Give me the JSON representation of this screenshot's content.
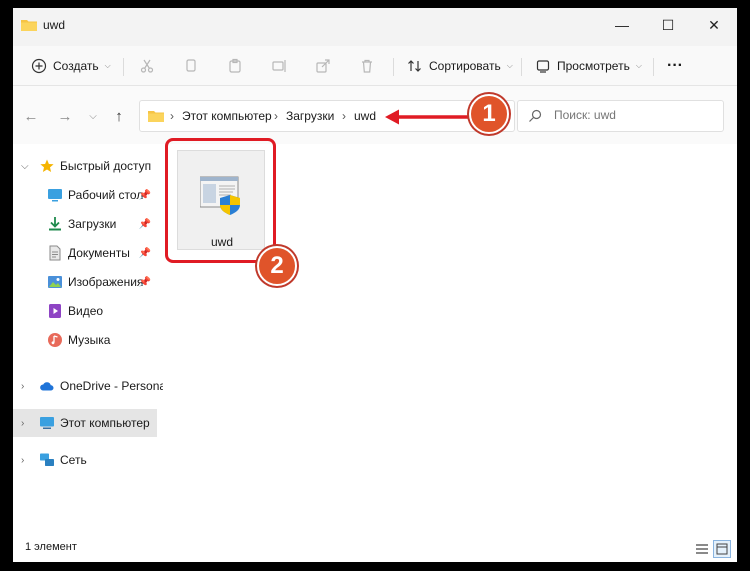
{
  "window": {
    "title": "uwd"
  },
  "controls": {
    "minimize": "—",
    "maximize": "☐",
    "close": "✕"
  },
  "toolbar": {
    "new_label": "Создать",
    "sort_label": "Сортировать",
    "view_label": "Просмотреть",
    "more": "···"
  },
  "nav": {
    "breadcrumb": [
      "Этот компьютер",
      "Загрузки",
      "uwd"
    ],
    "separator": "›",
    "search_placeholder": "Поиск: uwd"
  },
  "sidebar": {
    "quick_access": "Быстрый доступ",
    "items": [
      "Рабочий стол",
      "Загрузки",
      "Документы",
      "Изображения",
      "Видео",
      "Музыка"
    ],
    "onedrive": "OneDrive - Personal",
    "this_pc": "Этот компьютер",
    "network": "Сеть"
  },
  "files": [
    {
      "name": "uwd"
    }
  ],
  "status": {
    "count": "1 элемент"
  },
  "annotations": {
    "badge1": "1",
    "badge2": "2"
  },
  "colors": {
    "annotation_red": "#e01b24",
    "badge_fill": "#e0542a",
    "folder": "#f6c445"
  }
}
